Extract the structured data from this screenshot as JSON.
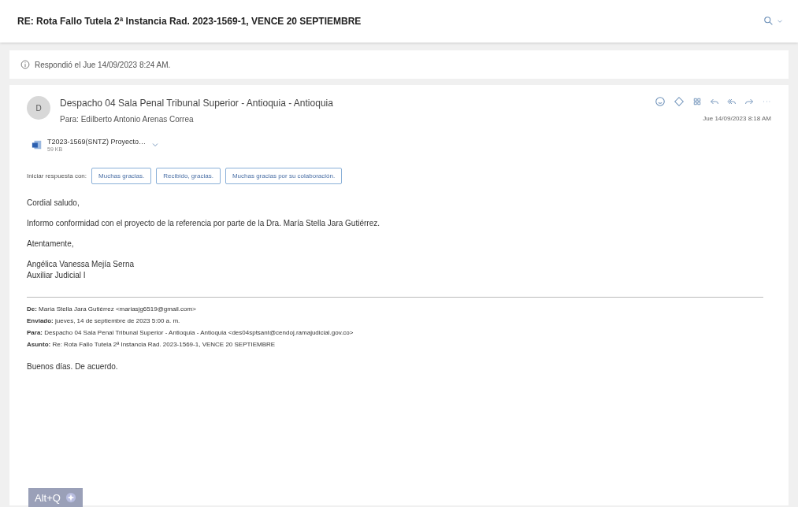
{
  "header": {
    "title": "RE: Rota Fallo Tutela 2ª Instancia Rad. 2023-1569-1, VENCE 20 SEPTIEMBRE"
  },
  "reply_notice": "Respondió el Jue 14/09/2023 8:24 AM.",
  "message": {
    "avatar": "D",
    "sender": "Despacho 04 Sala Penal Tribunal Superior - Antioquia - Antioquia",
    "to": "Para: Edilberto Antonio Arenas Correa",
    "date": "Jue 14/09/2023 8:18 AM",
    "attachment": {
      "name": "T2023-1569(SNTZ) Proyecto…",
      "size": "59 KB"
    },
    "quick_replies_label": "Iniciar respuesta con:",
    "quick_replies": [
      "Muchas gracias.",
      "Recibido, gracias.",
      "Muchas gracias por su colaboración."
    ],
    "body": [
      "Cordial saludo,",
      "Informo conformidad con el proyecto de la referencia por parte de la Dra. María Stella Jara Gutiérrez.",
      "Atentamente,"
    ],
    "signature": [
      "Angélica Vanessa Mejía Serna",
      "Auxiliar Judicial I"
    ],
    "quoted_header": [
      "**De:** María Stella Jara Gutiérrez <mariasjg6519@gmail.com>",
      "**Enviado:** jueves, 14 de septiembre de 2023 5:00 a. m.",
      "**Para:** Despacho 04 Sala Penal Tribunal Superior - Antioquia - Antioquia <des04sptsant@cendoj.ramajudicial.gov.co>",
      "**Asunto:** Re: Rota Fallo Tutela 2ª Instancia Rad. 2023-1569-1, VENCE 20 SEPTIEMBRE"
    ],
    "quoted_body": [
      "Buenos días. De acuerdo."
    ]
  },
  "shortcut_badge": "Alt+Q"
}
